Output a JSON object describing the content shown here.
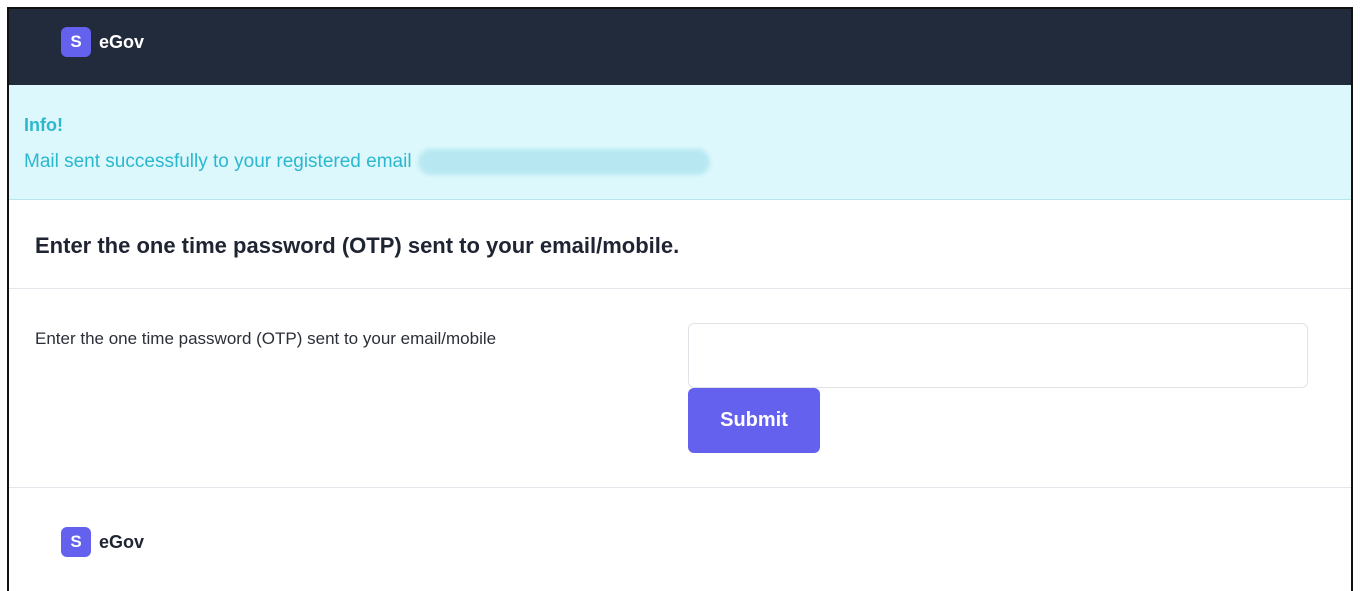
{
  "header": {
    "logo_badge": "S",
    "logo_text": "eGov"
  },
  "info": {
    "title": "Info!",
    "message": "Mail sent successfully to your registered email"
  },
  "form": {
    "heading": "Enter the one time password (OTP) sent to your email/mobile.",
    "field_label": "Enter the one time password (OTP) sent to your email/mobile",
    "otp_value": "",
    "otp_placeholder": "",
    "submit_label": "Submit"
  },
  "footer": {
    "logo_badge": "S",
    "logo_text": "eGov"
  },
  "colors": {
    "header_bg": "#222b3c",
    "brand": "#6461ef",
    "info_bg": "#dcf8fc",
    "info_text": "#2bb8cf"
  }
}
